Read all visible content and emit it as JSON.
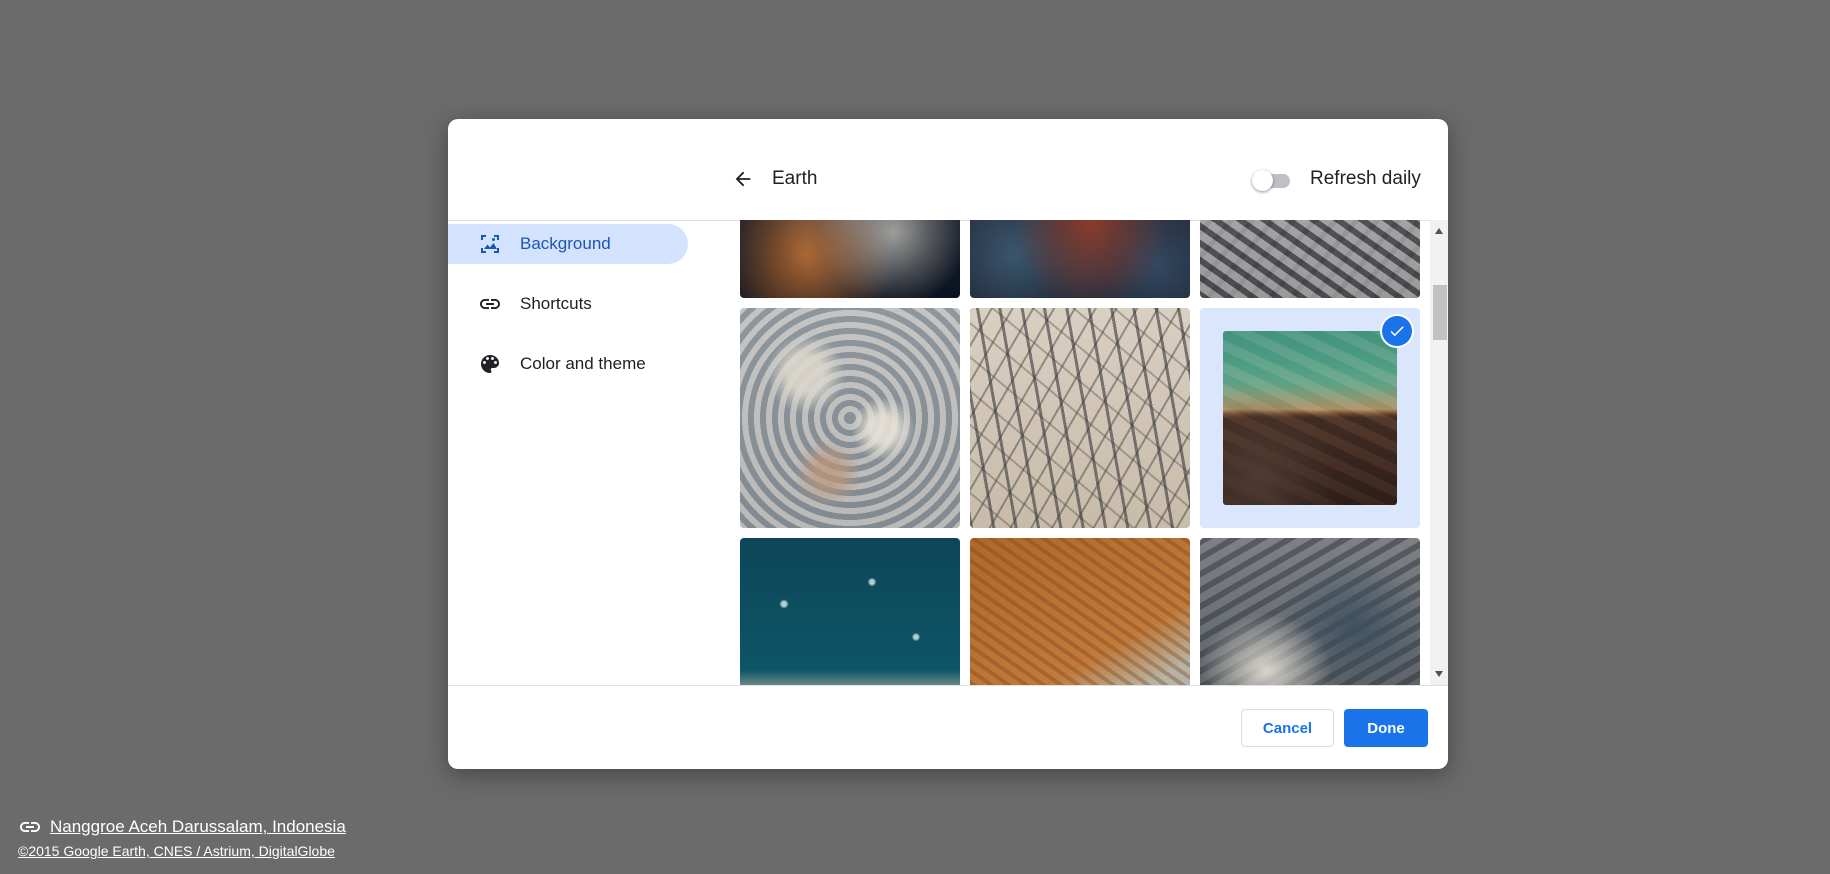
{
  "header": {
    "title": "Earth",
    "refresh_label": "Refresh daily",
    "refresh_on": false
  },
  "sidebar": {
    "items": [
      {
        "label": "Background",
        "icon": "background-icon",
        "active": true
      },
      {
        "label": "Shortcuts",
        "icon": "link-icon",
        "active": false
      },
      {
        "label": "Color and theme",
        "icon": "palette-icon",
        "active": false
      }
    ]
  },
  "footer": {
    "cancel_label": "Cancel",
    "done_label": "Done"
  },
  "attribution": {
    "location": "Nanggroe Aceh Darussalam, Indonesia",
    "copyright": "©2015 Google Earth, CNES / Astrium, DigitalGlobe"
  },
  "colors": {
    "accent": "#1a73e8",
    "active_nav": "#d3e3fd",
    "backdrop": "#6b6b6b"
  }
}
